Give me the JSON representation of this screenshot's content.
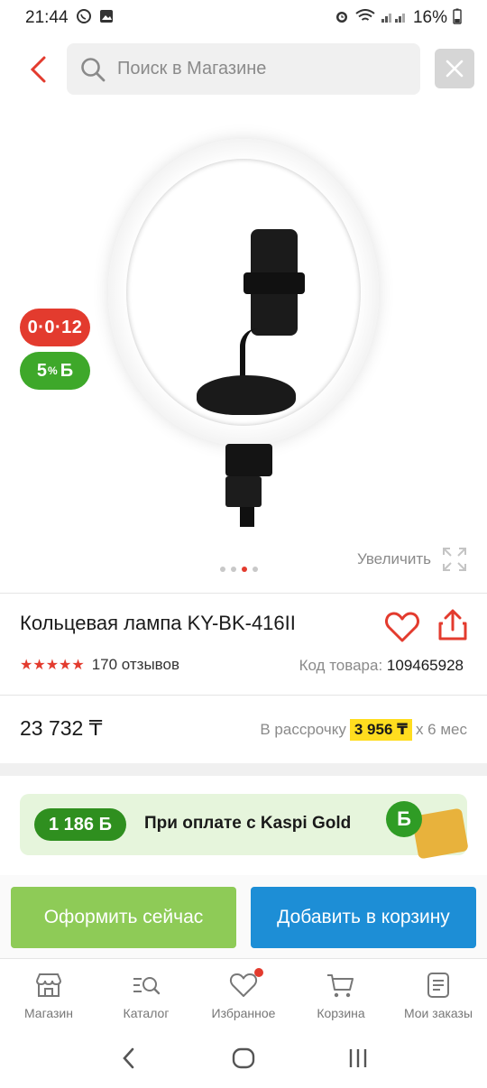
{
  "status_bar": {
    "time": "21:44",
    "battery": "16%"
  },
  "search": {
    "placeholder": "Поиск в Магазине"
  },
  "gallery": {
    "badge_installment": "0·0·12",
    "badge_bonus_value": "5",
    "badge_bonus_percent": "%",
    "badge_bonus_currency": "Б",
    "zoom_label": "Увеличить",
    "page_count": 4,
    "active_page": 3
  },
  "product": {
    "title": "Кольцевая лампа KY-BK-416II",
    "rating_stars": "★★★★★",
    "reviews": "170 отзывов",
    "sku_label": "Код товара:",
    "sku_value": "109465928",
    "price": "23 732 ₸",
    "installment_prefix": "В рассрочку",
    "installment_amount": "3 956 ₸",
    "installment_suffix": "х 6 мес"
  },
  "kaspi_gold": {
    "bonus": "1 186 Б",
    "text": "При оплате с Kaspi Gold",
    "coin": "Б"
  },
  "actions": {
    "checkout_label": "Оформить сейчас",
    "cart_label": "Добавить в корзину"
  },
  "bottom_nav": {
    "items": [
      {
        "label": "Магазин",
        "icon": "store-icon"
      },
      {
        "label": "Каталог",
        "icon": "catalog-search-icon"
      },
      {
        "label": "Избранное",
        "icon": "heart-icon"
      },
      {
        "label": "Корзина",
        "icon": "cart-icon"
      },
      {
        "label": "Мои заказы",
        "icon": "orders-icon"
      }
    ]
  },
  "colors": {
    "accent_red": "#e33b2e",
    "bonus_green": "#3ea82a",
    "checkout_green": "#8ecb57",
    "cart_blue": "#1d8ed6",
    "installment_yellow": "#ffdd1f"
  }
}
